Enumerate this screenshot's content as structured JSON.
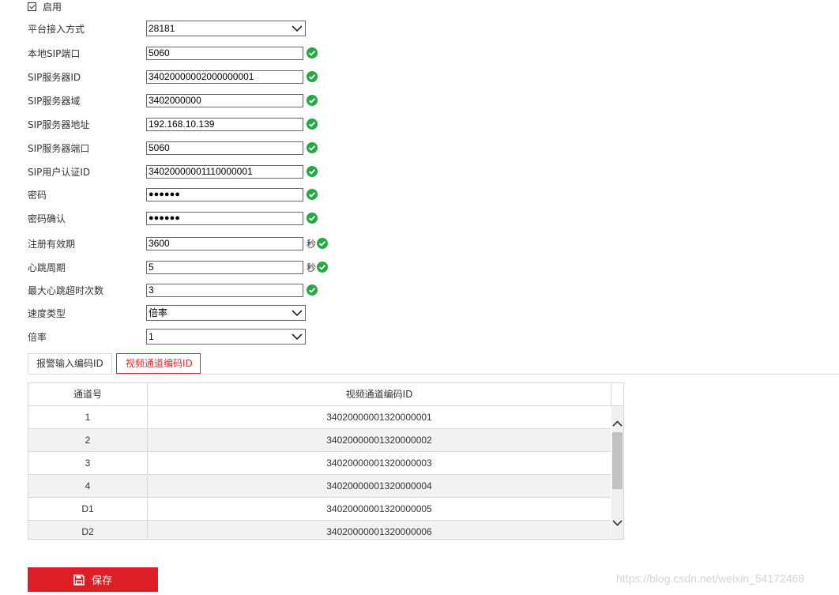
{
  "enable": {
    "label": "启用",
    "checked": true
  },
  "form": {
    "access_mode": {
      "label": "平台接入方式",
      "value": "28181"
    },
    "local_sip_port": {
      "label": "本地SIP端口",
      "value": "5060"
    },
    "sip_server_id": {
      "label": "SIP服务器ID",
      "value": "34020000002000000001"
    },
    "sip_server_domain": {
      "label": "SIP服务器域",
      "value": "3402000000"
    },
    "sip_server_address": {
      "label": "SIP服务器地址",
      "value": "192.168.10.139"
    },
    "sip_server_port": {
      "label": "SIP服务器端口",
      "value": "5060"
    },
    "sip_user_auth_id": {
      "label": "SIP用户认证ID",
      "value": "34020000001110000001"
    },
    "password": {
      "label": "密码",
      "value": "●●●●●●"
    },
    "password_confirm": {
      "label": "密码确认",
      "value": "●●●●●●"
    },
    "register_validity": {
      "label": "注册有效期",
      "value": "3600",
      "unit": "秒"
    },
    "heartbeat_period": {
      "label": "心跳周期",
      "value": "5",
      "unit": "秒"
    },
    "max_heartbeat_timeouts": {
      "label": "最大心跳超时次数",
      "value": "3"
    },
    "speed_type": {
      "label": "速度类型",
      "value": "倍率"
    },
    "rate": {
      "label": "倍率",
      "value": "1"
    }
  },
  "tabs": [
    {
      "label": "报警输入编码ID",
      "active": false
    },
    {
      "label": "视频通道编码ID",
      "active": true
    }
  ],
  "table": {
    "columns": [
      "通道号",
      "视频通道编码ID"
    ],
    "rows": [
      [
        "1",
        "34020000001320000001"
      ],
      [
        "2",
        "34020000001320000002"
      ],
      [
        "3",
        "34020000001320000003"
      ],
      [
        "4",
        "34020000001320000004"
      ],
      [
        "D1",
        "34020000001320000005"
      ],
      [
        "D2",
        "34020000001320000006"
      ]
    ]
  },
  "save_button": {
    "label": "保存"
  },
  "watermark": "https://blog.csdn.net/weixin_54172468",
  "colors": {
    "accent": "#dc1e27",
    "ok": "#27a844",
    "tab_active": "#d9292d"
  }
}
